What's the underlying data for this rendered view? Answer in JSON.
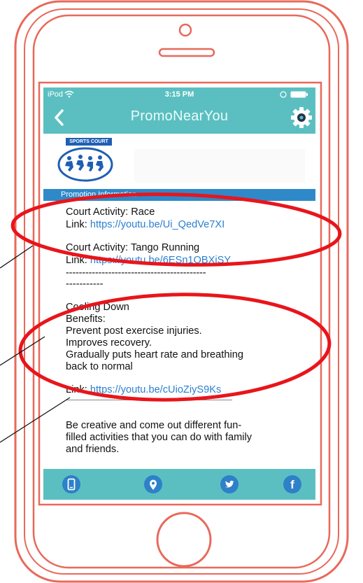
{
  "status_bar": {
    "carrier": "iPod",
    "time": "3:15 PM"
  },
  "nav": {
    "title": "PromoNearYou",
    "back_icon": "chevron-left-icon",
    "settings_icon": "gear-icon"
  },
  "logo": {
    "text": "SPORTS COURT",
    "icon": "running-figures-logo"
  },
  "promo_header": "Promotion Information",
  "activities": [
    {
      "title": "Court Activity: Race",
      "link_prefix": "Link: ",
      "link": "https://youtu.be/Ui_QedVe7XI"
    },
    {
      "title": "Court Activity: Tango Running",
      "link_prefix": "Link: ",
      "link": "https://youtu.be/6ESn1OBXiSY"
    }
  ],
  "divider_line_1": "-------------------------------------------",
  "divider_line_2": "-----------",
  "cooldown": {
    "title": "Cooling Down",
    "benefits_label": "Benefits:",
    "lines": [
      "Prevent post exercise injuries.",
      "Improves recovery.",
      "Gradually puts heart rate and breathing",
      "back to normal"
    ],
    "link_prefix": "Link: ",
    "link": "https://youtu.be/cUioZiyS9Ks"
  },
  "closing": [
    "Be creative and come out different fun-",
    "filled activities that you can do with family",
    "and friends."
  ],
  "tab_bar": [
    {
      "icon": "mobile-phone-icon"
    },
    {
      "icon": "map-pin-icon"
    },
    {
      "icon": "twitter-bird-icon"
    },
    {
      "icon": "facebook-icon",
      "glyph": "f"
    }
  ],
  "colors": {
    "phone_outline": "#e8695a",
    "app_teal": "#5bbfc1",
    "header_blue": "#2f89c9",
    "link_blue": "#2a7fd0",
    "annotation_red": "#e8151b"
  }
}
